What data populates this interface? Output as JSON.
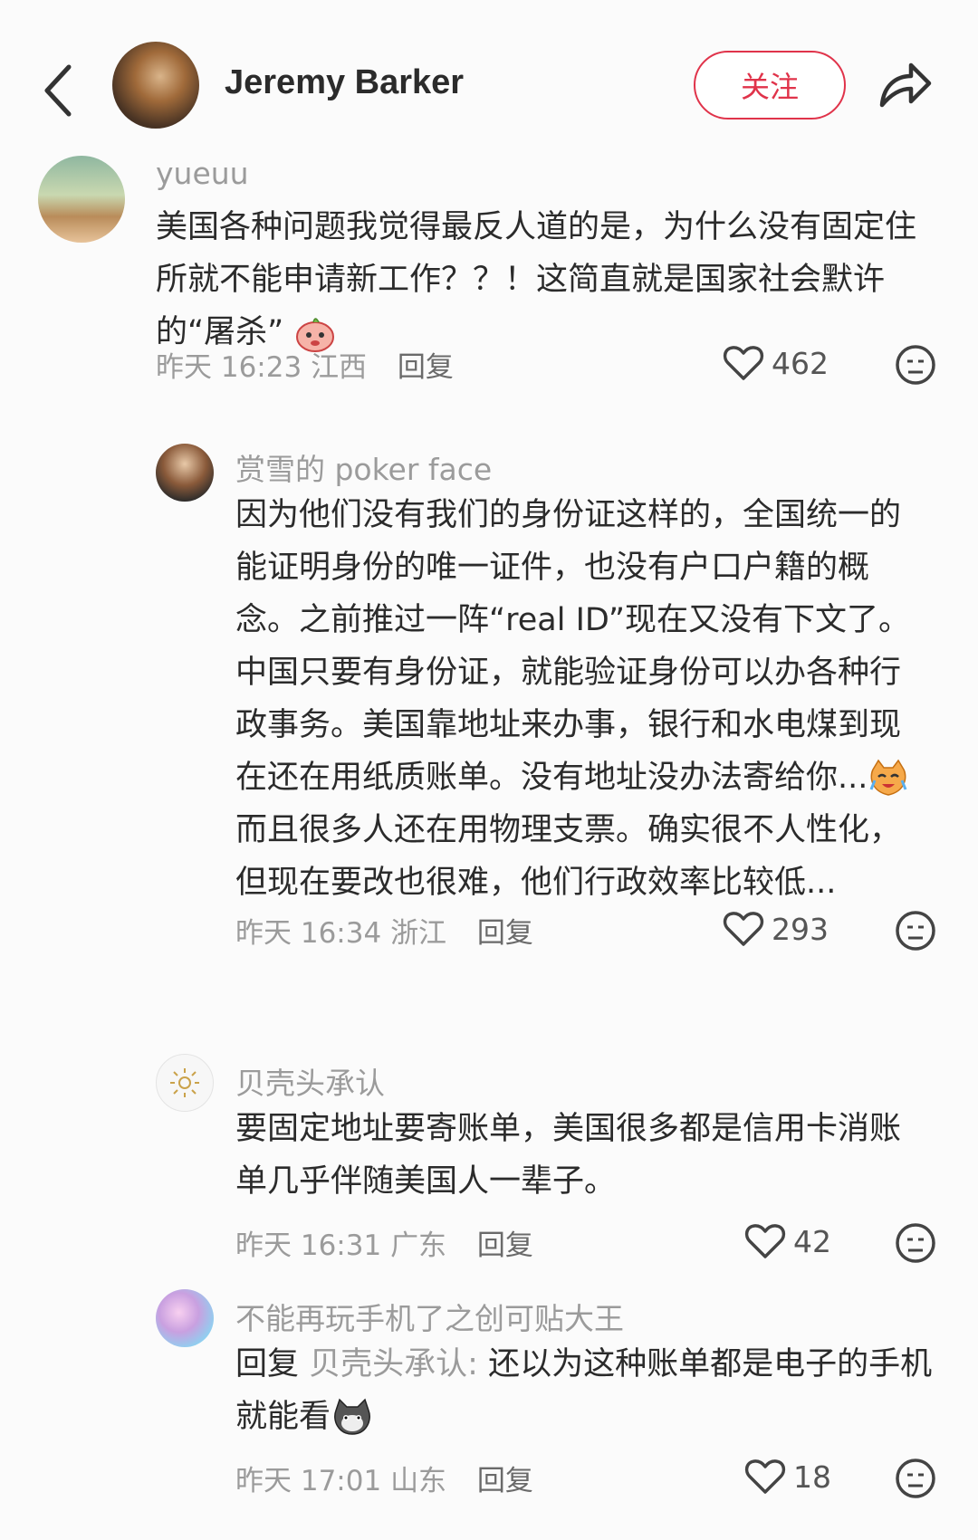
{
  "header": {
    "name": "Jeremy Barker",
    "follow_label": "关注"
  },
  "comments": [
    {
      "username": "yueuu",
      "text": "美国各种问题我觉得最反人道的是，为什么没有固定住所就不能申请新工作？？！这简直就是国家社会默许的“屠杀”",
      "time": "昨天 16:23",
      "location": "江西",
      "reply_label": "回复",
      "likes": "462"
    },
    {
      "username": "赏雪的 poker face",
      "text": "因为他们没有我们的身份证这样的，全国统一的能证明身份的唯一证件，也没有户口户籍的概念。之前推过一阵“real ID”现在又没有下文了。中国只要有身份证，就能验证身份可以办各种行政事务。美国靠地址来办事，银行和水电煤到现在还在用纸质账单。没有地址没办法寄给你...",
      "text2": "而且很多人还在用物理支票。确实很不人性化，但现在要改也很难，他们行政效率比较低...",
      "time": "昨天 16:34",
      "location": "浙江",
      "reply_label": "回复",
      "likes": "293"
    },
    {
      "username": "贝壳头承认",
      "text": "要固定地址要寄账单，美国很多都是信用卡消账单几乎伴随美国人一辈子。",
      "time": "昨天 16:31",
      "location": "广东",
      "reply_label": "回复",
      "likes": "42"
    },
    {
      "username": "不能再玩手机了之创可贴大王",
      "reply_prefix": "回复",
      "reply_to": "贝壳头承认:",
      "text": "还以为这种账单都是电子的手机就能看",
      "time": "昨天 17:01",
      "location": "山东",
      "reply_label": "回复",
      "likes": "18"
    }
  ],
  "icons": [
    "back-arrow-icon",
    "share-icon",
    "heart-icon",
    "dislike-face-icon",
    "emoji-icon"
  ],
  "colors": {
    "accent": "#e0334a",
    "muted": "#9b9b9b",
    "text": "#2b2b2b"
  }
}
